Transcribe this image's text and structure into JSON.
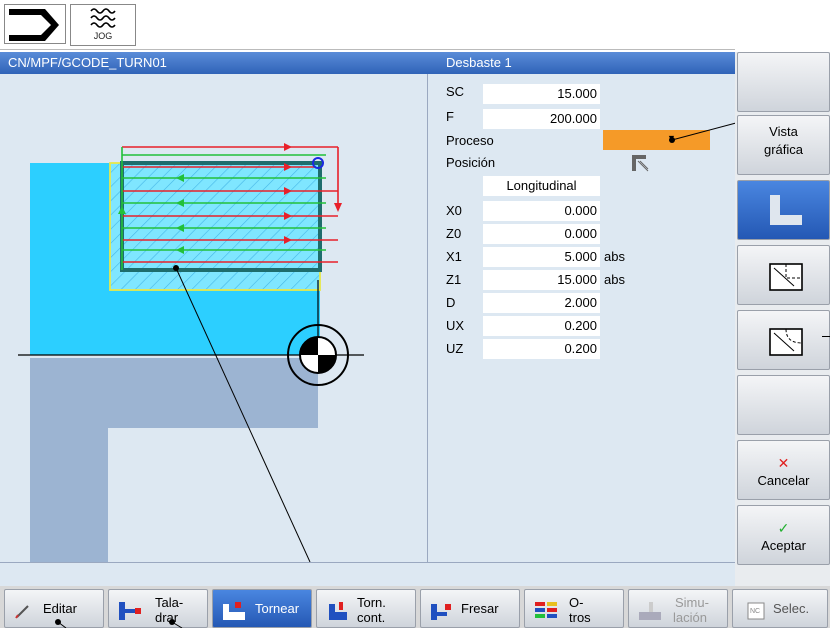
{
  "header": {
    "mode_icon": "machine-mode-icon",
    "jog_label": "JOG",
    "program_path": "CN/MPF/GCODE_TURN01",
    "cycle_title": "Desbaste 1"
  },
  "params": {
    "sc": {
      "label": "SC",
      "value": "15.000"
    },
    "f": {
      "label": "F",
      "value": "200.000"
    },
    "proceso": {
      "label": "Proceso"
    },
    "posicion": {
      "label": "Posición"
    },
    "direction": "Longitudinal",
    "x0": {
      "label": "X0",
      "value": "0.000"
    },
    "z0": {
      "label": "Z0",
      "value": "0.000"
    },
    "x1": {
      "label": "X1",
      "value": "5.000",
      "unit": "abs"
    },
    "z1": {
      "label": "Z1",
      "value": "15.000",
      "unit": "abs"
    },
    "d": {
      "label": "D",
      "value": "2.000"
    },
    "ux": {
      "label": "UX",
      "value": "0.200"
    },
    "uz": {
      "label": "UZ",
      "value": "0.200"
    }
  },
  "vertical_softkeys": {
    "vista_line1": "Vista",
    "vista_line2": "gráfica",
    "cancelar": "Cancelar",
    "aceptar": "Aceptar"
  },
  "horizontal_softkeys": {
    "editar": "Editar",
    "taladrar_1": "Tala-",
    "taladrar_2": "drar",
    "tornear": "Tornear",
    "torn_1": "Torn.",
    "torn_2": "cont.",
    "fresar": "Fresar",
    "otros_1": "O-",
    "otros_2": "tros",
    "simu_1": "Simu-",
    "simu_2": "lación",
    "selec": "Selec."
  },
  "colors": {
    "accent_blue": "#2f63b8",
    "proceso_orange": "#f59a28",
    "roughing_red": "#e8202a",
    "return_green": "#22c03a",
    "blank_yellow": "#e8e84a"
  }
}
